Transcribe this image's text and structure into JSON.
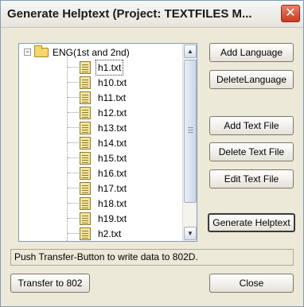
{
  "window": {
    "title": "Generate Helptext (Project: TEXTFILES M...",
    "close_symbol": "✕"
  },
  "tree": {
    "folder": {
      "expander": "−",
      "label": "ENG(1st and 2nd)"
    },
    "files": [
      {
        "label": "h1.txt",
        "selected": true
      },
      {
        "label": "h10.txt"
      },
      {
        "label": "h11.txt"
      },
      {
        "label": "h12.txt"
      },
      {
        "label": "h13.txt"
      },
      {
        "label": "h14.txt"
      },
      {
        "label": "h15.txt"
      },
      {
        "label": "h16.txt"
      },
      {
        "label": "h17.txt"
      },
      {
        "label": "h18.txt"
      },
      {
        "label": "h19.txt"
      },
      {
        "label": "h2.txt"
      }
    ],
    "scroll_up_symbol": "▲",
    "scroll_down_symbol": "▼"
  },
  "buttons": {
    "add_language": "Add Language",
    "delete_language": "DeleteLanguage",
    "add_text_file": "Add Text File",
    "delete_text_file": "Delete Text File",
    "edit_text_file": "Edit Text File",
    "generate_helptext": "Generate Helptext",
    "transfer": "Transfer to 802",
    "close": "Close"
  },
  "status": {
    "message": "Push Transfer-Button to write data to 802D."
  }
}
